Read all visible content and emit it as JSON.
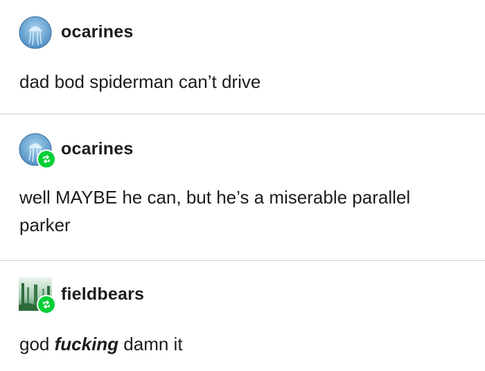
{
  "posts": [
    {
      "username": "ocarines",
      "avatar": "jellyfish-avatar",
      "reblog": false,
      "text": "dad bod spiderman can’t drive"
    },
    {
      "username": "ocarines",
      "avatar": "jellyfish-avatar",
      "reblog": true,
      "text": "well MAYBE he can, but he’s a miserable parallel parker"
    },
    {
      "username": "fieldbears",
      "avatar": "forest-avatar",
      "reblog": true,
      "text_before": "god ",
      "text_emphasis": "fucking",
      "text_after": " damn it"
    }
  ],
  "colors": {
    "reblog_badge": "#00cf35",
    "text": "#1c1c1c",
    "divider": "#d2d2d2"
  },
  "icons": {
    "reblog": "reblog-icon"
  }
}
